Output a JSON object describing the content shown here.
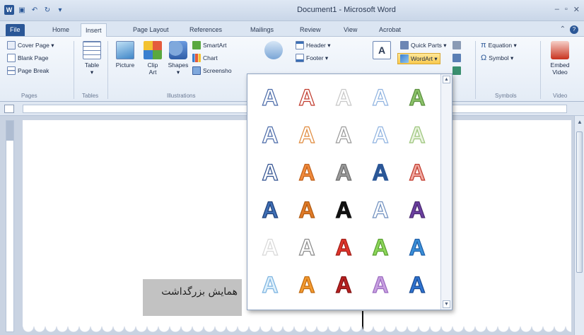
{
  "window": {
    "title": "Document1 - Microsoft Word",
    "controls": [
      "–",
      "▫",
      "✕"
    ]
  },
  "tabs": [
    "File",
    "Home",
    "Insert",
    "Page Layout",
    "References",
    "Mailings",
    "Review",
    "View",
    "Acrobat"
  ],
  "active_tab": "Insert",
  "ribbon": {
    "pages": {
      "cover_page": "Cover Page ▾",
      "blank_page": "Blank Page",
      "page_break": "Page Break",
      "label": "Pages"
    },
    "tables": {
      "table": "Table",
      "table_arrow": "▾",
      "label": "Tables"
    },
    "illustrations": {
      "picture": "Picture",
      "clip_art": "Clip Art",
      "shapes": "Shapes",
      "shapes_arrow": "▾",
      "smartart": "SmartArt",
      "chart": "Chart",
      "screenshot": "Screensho",
      "label": "Illustrations"
    },
    "header_footer": {
      "header": "Header ▾",
      "footer": "Footer ▾"
    },
    "text": {
      "quick_parts": "Quick Parts ▾",
      "wordart": "WordArt ▾"
    },
    "symbols": {
      "equation": "Equation ▾",
      "symbol": "Symbol ▾",
      "label": "Symbols"
    },
    "media": {
      "embed_video": "Embed Video",
      "label": "Video"
    }
  },
  "document": {
    "text": "همایش بزرگداشت"
  },
  "wordart_gallery": {
    "glyph": "A",
    "styles": [
      {
        "fill": "#ffffff",
        "stroke": "#4a6aa8"
      },
      {
        "fill": "#ffffff",
        "stroke": "#c0392b"
      },
      {
        "fill": "#ffffff",
        "stroke": "#c8c8c8"
      },
      {
        "fill": "#ffffff",
        "stroke": "#8fb3e0"
      },
      {
        "fill": "#8cc26a",
        "stroke": "#5a8f3e"
      },
      {
        "fill": "#ffffff",
        "stroke": "#4a6aa8"
      },
      {
        "fill": "#ffffff",
        "stroke": "#e08a3c"
      },
      {
        "fill": "#ffffff",
        "stroke": "#9a9a9a"
      },
      {
        "fill": "#ffffff",
        "stroke": "#8fb3e0"
      },
      {
        "fill": "#e9f3df",
        "stroke": "#9cc57c"
      },
      {
        "fill": "#ffffff",
        "stroke": "#2e4f8f"
      },
      {
        "fill": "#f08a3c",
        "stroke": "#c0601a"
      },
      {
        "fill": "#9a9a9a",
        "stroke": "#6e6e6e"
      },
      {
        "fill": "#2b5797",
        "stroke": "#2b5797"
      },
      {
        "fill": "#f0a8a0",
        "stroke": "#c0392b"
      },
      {
        "fill": "#3f6fb5",
        "stroke": "#1f3f77"
      },
      {
        "fill": "#e07a28",
        "stroke": "#b05a10"
      },
      {
        "fill": "#111111",
        "stroke": "#111111"
      },
      {
        "fill": "#ffffff",
        "stroke": "#6f8fbf"
      },
      {
        "fill": "#6b3fa0",
        "stroke": "#4a2a70"
      },
      {
        "fill": "#ffffff",
        "stroke": "#d8d8d8"
      },
      {
        "fill": "#ffffff",
        "stroke": "#8a8a8a"
      },
      {
        "fill": "#e0342b",
        "stroke": "#a01f18"
      },
      {
        "fill": "#8cd65a",
        "stroke": "#5aa030"
      },
      {
        "fill": "#3a8fd8",
        "stroke": "#1e5fa8"
      },
      {
        "fill": "#dff0fb",
        "stroke": "#7bb3e0"
      },
      {
        "fill": "#f39a30",
        "stroke": "#c06a10"
      },
      {
        "fill": "#b82020",
        "stroke": "#801010"
      },
      {
        "fill": "#c8a0e0",
        "stroke": "#9a6ac0"
      },
      {
        "fill": "#2f73d0",
        "stroke": "#1a4a90"
      }
    ]
  },
  "colors": {
    "file_tab": "#2b5797",
    "wordart_highlight": "#f8c94e"
  }
}
